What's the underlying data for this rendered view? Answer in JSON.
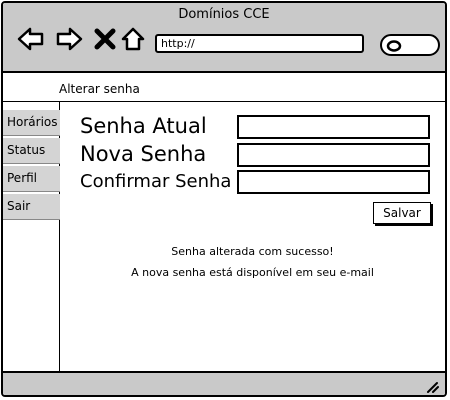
{
  "window": {
    "title": "Domínios CCE",
    "url": "http://"
  },
  "toolbar": {
    "back_icon": "arrow-left-icon",
    "forward_icon": "arrow-right-icon",
    "stop_icon": "close-icon",
    "home_icon": "home-icon",
    "search_icon": "search-icon"
  },
  "breadcrumb": "Alterar senha",
  "sidebar": {
    "items": [
      {
        "label": "Horários"
      },
      {
        "label": "Status"
      },
      {
        "label": "Perfil"
      },
      {
        "label": "Sair"
      }
    ]
  },
  "form": {
    "current_password_label": "Senha Atual",
    "current_password_value": "",
    "new_password_label": "Nova Senha",
    "new_password_value": "",
    "confirm_password_label": "Confirmar Senha",
    "confirm_password_value": "",
    "save_label": "Salvar"
  },
  "messages": {
    "success": "Senha alterada com sucesso!",
    "email_notice": "A nova senha está disponível em seu e-mail"
  },
  "colors": {
    "chrome": "#c9c9c9",
    "sidebar_item": "#d4d4d4",
    "border": "#000000"
  }
}
